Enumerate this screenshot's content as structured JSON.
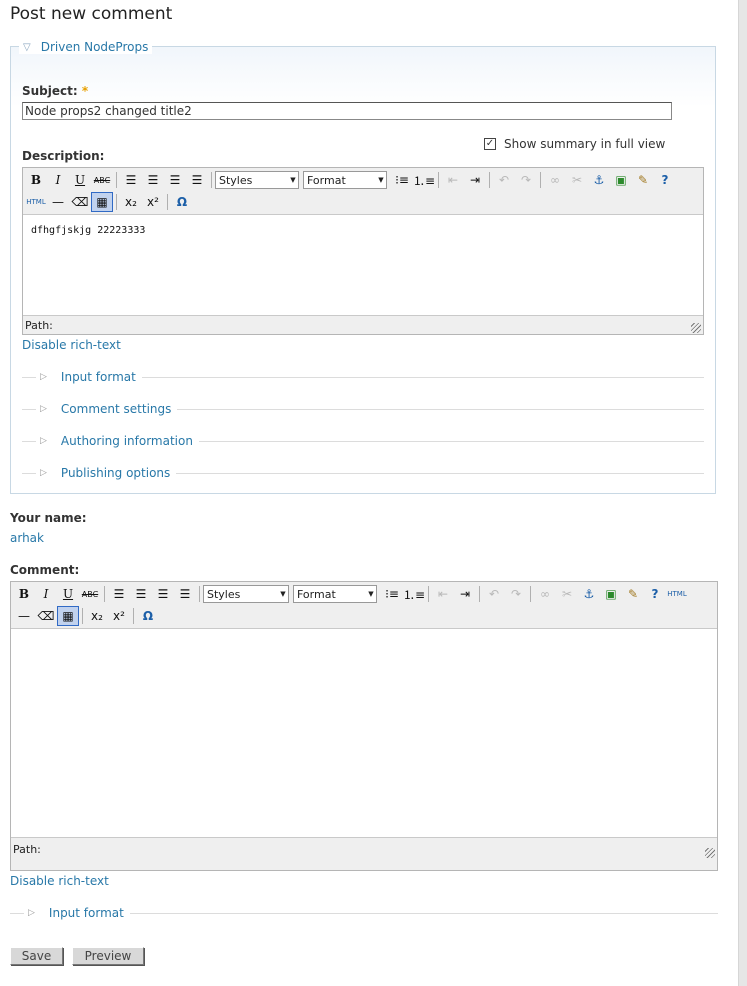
{
  "page": {
    "title": "Post new comment"
  },
  "nodeprops": {
    "legend": "Driven NodeProps",
    "subject": {
      "label": "Subject:",
      "required_mark": "*",
      "value": "Node props2 changed title2"
    },
    "summary_checkbox": {
      "label": "Show summary in full view",
      "checked": true
    },
    "description": {
      "label": "Description:",
      "content": "dfhgfjskjg 22223333",
      "path_label": "Path:",
      "disable_richtext": "Disable rich-text"
    },
    "fieldsets": [
      "Input format",
      "Comment settings",
      "Authoring information",
      "Publishing options"
    ]
  },
  "editor_toolbar": {
    "bold": "B",
    "italic": "I",
    "underline": "U",
    "strike": "ABC",
    "styles_label": "Styles",
    "format_label": "Format",
    "html_label": "HTML",
    "omega": "Ω"
  },
  "your_name": {
    "label": "Your name:",
    "value": "arhak"
  },
  "comment": {
    "label": "Comment:",
    "path_label": "Path:",
    "disable_richtext": "Disable rich-text",
    "input_format": "Input format"
  },
  "buttons": {
    "save": "Save",
    "preview": "Preview"
  },
  "colors": {
    "link": "#2878a8",
    "required": "#e8a000",
    "fieldset_border": "#c8d8e4"
  }
}
